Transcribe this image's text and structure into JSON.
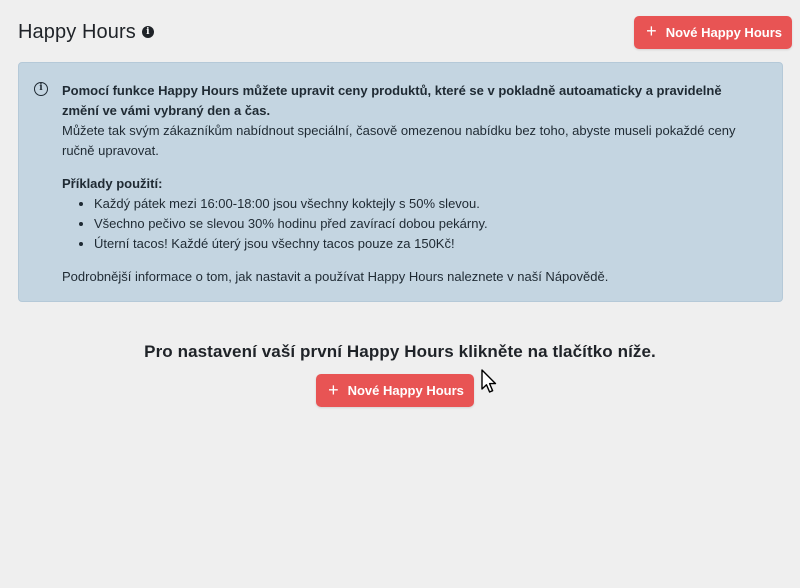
{
  "header": {
    "title": "Happy Hours",
    "info_icon": "info-circle-icon",
    "new_button_label": "Nové Happy Hours"
  },
  "info_panel": {
    "icon": "info-circle-icon",
    "intro_bold": "Pomocí funkce Happy Hours můžete upravit ceny produktů, které se v pokladně autoamaticky a pravidelně změní ve vámi vybraný den a čas.",
    "intro_text": "Můžete tak svým zákazníkům nabídnout speciální, časově omezenou nabídku bez toho, abyste museli pokaždé ceny ručně upravovat.",
    "examples_heading": "Příklady použití:",
    "examples": [
      "Každý pátek mezi 16:00-18:00 jsou všechny koktejly s 50% slevou.",
      "Všechno pečivo se slevou 30% hodinu před zavírací dobou pekárny.",
      "Úterní tacos! Každé úterý jsou všechny tacos pouze za 150Kč!"
    ],
    "more_info": "Podrobnější informace o tom, jak nastavit a používat Happy Hours naleznete v naší Nápovědě."
  },
  "empty_state": {
    "text": "Pro nastavení vaší první Happy Hours klikněte na tlačítko níže.",
    "button_label": "Nové Happy Hours"
  },
  "colors": {
    "accent": "#e85454",
    "info_panel_bg": "#c4d5e1",
    "page_bg": "#efefef"
  }
}
